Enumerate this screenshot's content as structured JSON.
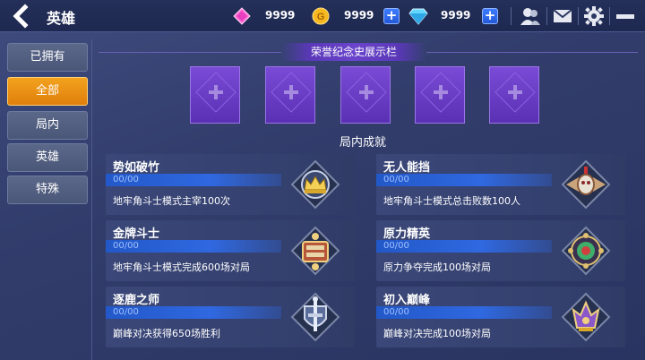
{
  "header": {
    "title": "英雄",
    "currencies": [
      {
        "icon": "pink-gem-icon",
        "value": "9999"
      },
      {
        "icon": "gold-coin-icon",
        "value": "9999"
      },
      {
        "icon": "blue-diamond-icon",
        "value": "9999"
      }
    ],
    "icons": [
      "friends-icon",
      "mail-icon",
      "settings-gear-icon",
      "menu-icon"
    ]
  },
  "sidebar": {
    "items": [
      {
        "label": "已拥有",
        "active": false
      },
      {
        "label": "全部",
        "active": true
      },
      {
        "label": "局内",
        "active": false
      },
      {
        "label": "英雄",
        "active": false
      },
      {
        "label": "特殊",
        "active": false
      }
    ]
  },
  "showcase": {
    "title": "荣誉纪念史展示栏",
    "slot_count": 5
  },
  "achievements": {
    "section_title": "局内成就",
    "cards": [
      {
        "title": "势如破竹",
        "progress": "00/00",
        "desc": "地牢角斗士模式主宰100次",
        "badge": "crown-badge-icon"
      },
      {
        "title": "无人能挡",
        "progress": "00/00",
        "desc": "地牢角斗士模式总击败数100人",
        "badge": "winged-skull-badge-icon"
      },
      {
        "title": "金牌斗士",
        "progress": "00/00",
        "desc": "地牢角斗士模式完成600场对局",
        "badge": "gold-fighter-badge-icon"
      },
      {
        "title": "原力精英",
        "progress": "00/00",
        "desc": "原力争夺完成100场对局",
        "badge": "force-elite-badge-icon"
      },
      {
        "title": "逐鹿之师",
        "progress": "00/00",
        "desc": "巅峰对决获得650场胜利",
        "badge": "sword-shield-badge-icon"
      },
      {
        "title": "初入巅峰",
        "progress": "00/00",
        "desc": "巅峰对决完成100场对局",
        "badge": "peak-badge-icon"
      }
    ]
  },
  "colors": {
    "accent_orange": "#f2a21e",
    "slot_purple": "#6a44cc",
    "progress_blue": "#2f68e0"
  }
}
